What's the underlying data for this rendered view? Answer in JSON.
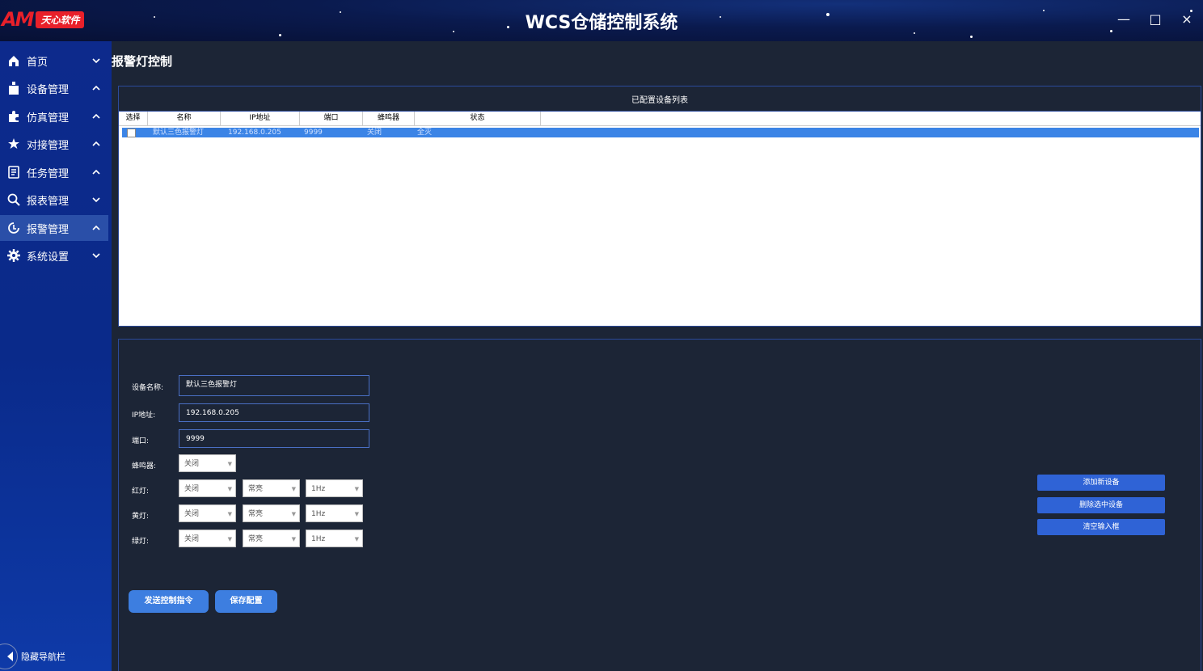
{
  "app": {
    "logo_mark": "AM",
    "logo_badge": "天心软件",
    "title": "WCS仓储控制系统",
    "window_controls": {
      "minimize": "—",
      "maximize": "□",
      "close": "×"
    }
  },
  "sidebar": {
    "items": [
      {
        "label": "首页",
        "icon": "home-icon",
        "chevron": "down"
      },
      {
        "label": "设备管理",
        "icon": "device-icon",
        "chevron": "up"
      },
      {
        "label": "仿真管理",
        "icon": "puzzle-icon",
        "chevron": "up"
      },
      {
        "label": "对接管理",
        "icon": "star-icon",
        "chevron": "up"
      },
      {
        "label": "任务管理",
        "icon": "document-icon",
        "chevron": "up"
      },
      {
        "label": "报表管理",
        "icon": "search-icon",
        "chevron": "down"
      },
      {
        "label": "报警管理",
        "icon": "alarm-icon",
        "chevron": "up",
        "active": true
      },
      {
        "label": "系统设置",
        "icon": "gear-icon",
        "chevron": "down"
      }
    ],
    "hide_nav_label": "隐藏导航栏"
  },
  "page": {
    "title": "报警灯控制"
  },
  "device_list": {
    "header": "已配置设备列表",
    "columns": [
      "选择",
      "名称",
      "IP地址",
      "端口",
      "蜂鸣器",
      "状态"
    ],
    "rows": [
      {
        "name": "默认三色报警灯",
        "ip": "192.168.0.205",
        "port": "9999",
        "buzzer": "关闭",
        "status": "全灭"
      }
    ]
  },
  "form": {
    "device_name_label": "设备名称:",
    "device_name_value": "默认三色报警灯",
    "ip_label": "IP地址:",
    "ip_value": "192.168.0.205",
    "port_label": "端口:",
    "port_value": "9999",
    "buzzer_label": "蜂鸣器:",
    "buzzer_value": "关闭",
    "red_label": "红灯:",
    "red_state": "关闭",
    "red_mode": "常亮",
    "red_freq": "1Hz",
    "yellow_label": "黄灯:",
    "yellow_state": "关闭",
    "yellow_mode": "常亮",
    "yellow_freq": "1Hz",
    "green_label": "绿灯:",
    "green_state": "关闭",
    "green_mode": "常亮",
    "green_freq": "1Hz",
    "send_button": "发送控制指令",
    "save_button": "保存配置"
  },
  "side_buttons": {
    "add": "添加新设备",
    "delete": "删除选中设备",
    "clear": "清空输入框"
  },
  "colors": {
    "accent": "#3d7ee0",
    "selected_row": "#3b84e6",
    "sidebar": "#0d2a8c",
    "logo_red": "#e8202a"
  }
}
